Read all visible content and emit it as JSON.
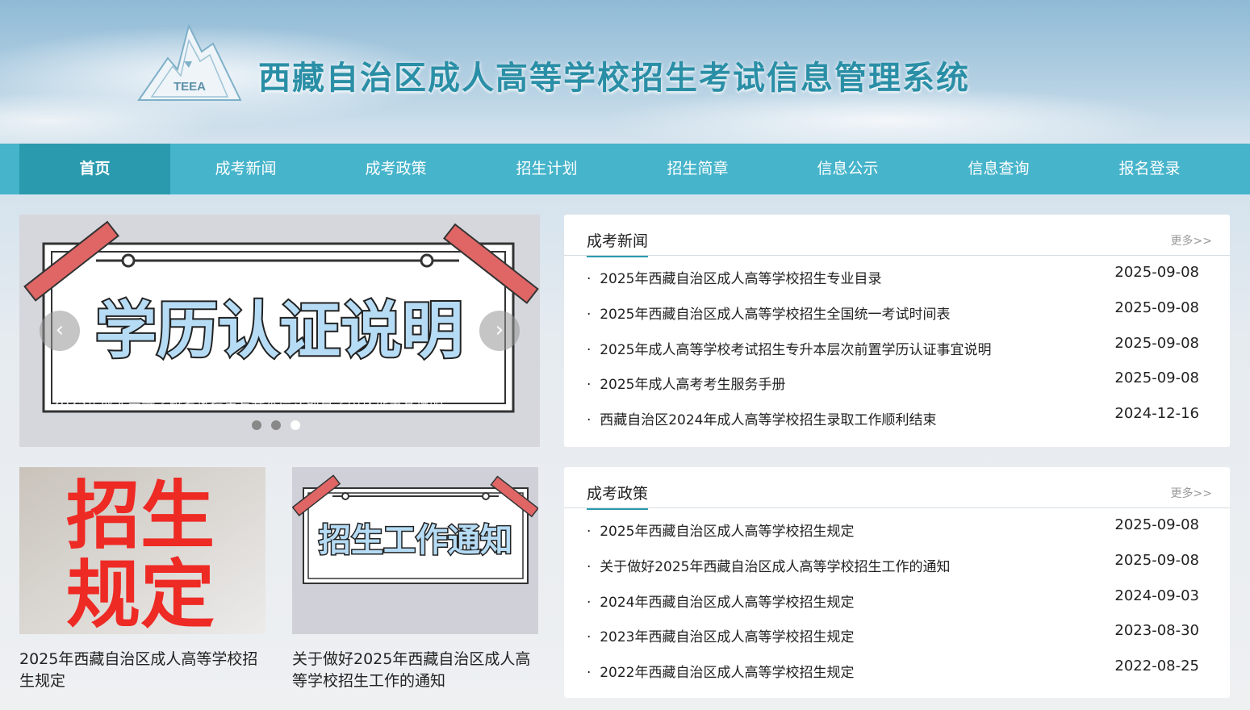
{
  "header": {
    "title": "西藏自治区成人高等学校招生考试信息管理系统",
    "logo_text": "TEEA"
  },
  "nav": {
    "items": [
      "首页",
      "成考新闻",
      "成考政策",
      "招生计划",
      "招生简章",
      "信息公示",
      "信息查询",
      "报名登录"
    ],
    "active": "首页"
  },
  "carousel": {
    "image_text": "学历认证说明",
    "caption": "2025年成人高等学校考试招生专升本层次前置学历认证事宜说明",
    "prev_label": "‹",
    "next_label": "›",
    "slide_count": 3,
    "active_slide": 3
  },
  "cards": [
    {
      "image_text_line1": "招生",
      "image_text_line2": "规定",
      "title": "2025年西藏自治区成人高等学校招生规定"
    },
    {
      "image_text": "招生工作通知",
      "title": "关于做好2025年西藏自治区成人高等学校招生工作的通知"
    }
  ],
  "news": {
    "title": "成考新闻",
    "more": "更多>>",
    "items": [
      {
        "text": "2025年西藏自治区成人高等学校招生专业目录",
        "date": "2025-09-08"
      },
      {
        "text": "2025年西藏自治区成人高等学校招生全国统一考试时间表",
        "date": "2025-09-08"
      },
      {
        "text": "2025年成人高等学校考试招生专升本层次前置学历认证事宜说明",
        "date": "2025-09-08"
      },
      {
        "text": "2025年成人高考考生服务手册",
        "date": "2025-09-08"
      },
      {
        "text": "西藏自治区2024年成人高等学校招生录取工作顺利结束",
        "date": "2024-12-16"
      }
    ]
  },
  "policy": {
    "title": "成考政策",
    "more": "更多>>",
    "items": [
      {
        "text": "2025年西藏自治区成人高等学校招生规定",
        "date": "2025-09-08"
      },
      {
        "text": "关于做好2025年西藏自治区成人高等学校招生工作的通知",
        "date": "2025-09-08"
      },
      {
        "text": "2024年西藏自治区成人高等学校招生规定",
        "date": "2024-09-03"
      },
      {
        "text": "2023年西藏自治区成人高等学校招生规定",
        "date": "2023-08-30"
      },
      {
        "text": "2022年西藏自治区成人高等学校招生规定",
        "date": "2022-08-25"
      }
    ]
  }
}
